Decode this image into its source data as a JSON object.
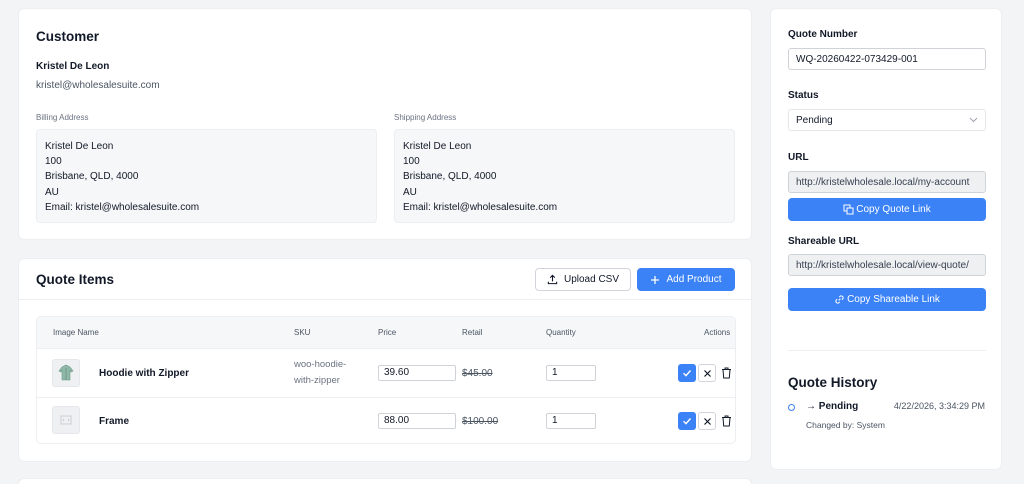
{
  "customer": {
    "title": "Customer",
    "name": "Kristel De Leon",
    "email": "kristel@wholesalesuite.com",
    "billing": {
      "label": "Billing Address",
      "lines": [
        "Kristel De Leon",
        "100",
        "Brisbane, QLD, 4000",
        "AU",
        "Email: kristel@wholesalesuite.com"
      ]
    },
    "shipping": {
      "label": "Shipping Address",
      "lines": [
        "Kristel De Leon",
        "100",
        "Brisbane, QLD, 4000",
        "AU",
        "Email: kristel@wholesalesuite.com"
      ]
    }
  },
  "quote_items": {
    "title": "Quote Items",
    "upload_label": "Upload CSV",
    "add_label": "Add Product",
    "columns": [
      "Image Name",
      "SKU",
      "Price",
      "Retail",
      "Quantity",
      "Actions"
    ],
    "rows": [
      {
        "name": "Hoodie with Zipper",
        "sku_lines": [
          "woo-hoodie-",
          "with-zipper"
        ],
        "price": "39.60",
        "retail": "$45.00",
        "quantity": "1"
      },
      {
        "name": "Frame",
        "sku_lines": [
          "",
          ""
        ],
        "price": "88.00",
        "retail": "$100.00",
        "quantity": "1"
      }
    ]
  },
  "sidebar": {
    "quote_number_label": "Quote Number",
    "quote_number": "WQ-20260422-073429-001",
    "status_label": "Status",
    "status_value": "Pending",
    "url_label": "URL",
    "url_value": "http://kristelwholesale.local/my-account",
    "copy_quote_link": "Copy Quote Link",
    "shareable_url_label": "Shareable URL",
    "shareable_url_value": "http://kristelwholesale.local/view-quote/",
    "copy_shareable_link": "Copy Shareable Link",
    "history_title": "Quote History",
    "history": [
      {
        "status": "→ Pending",
        "date": "4/22/2026, 3:34:29 PM",
        "changed_by": "Changed by: System"
      }
    ]
  },
  "colors": {
    "primary": "#3b82f6",
    "background": "#f3f4f6"
  }
}
